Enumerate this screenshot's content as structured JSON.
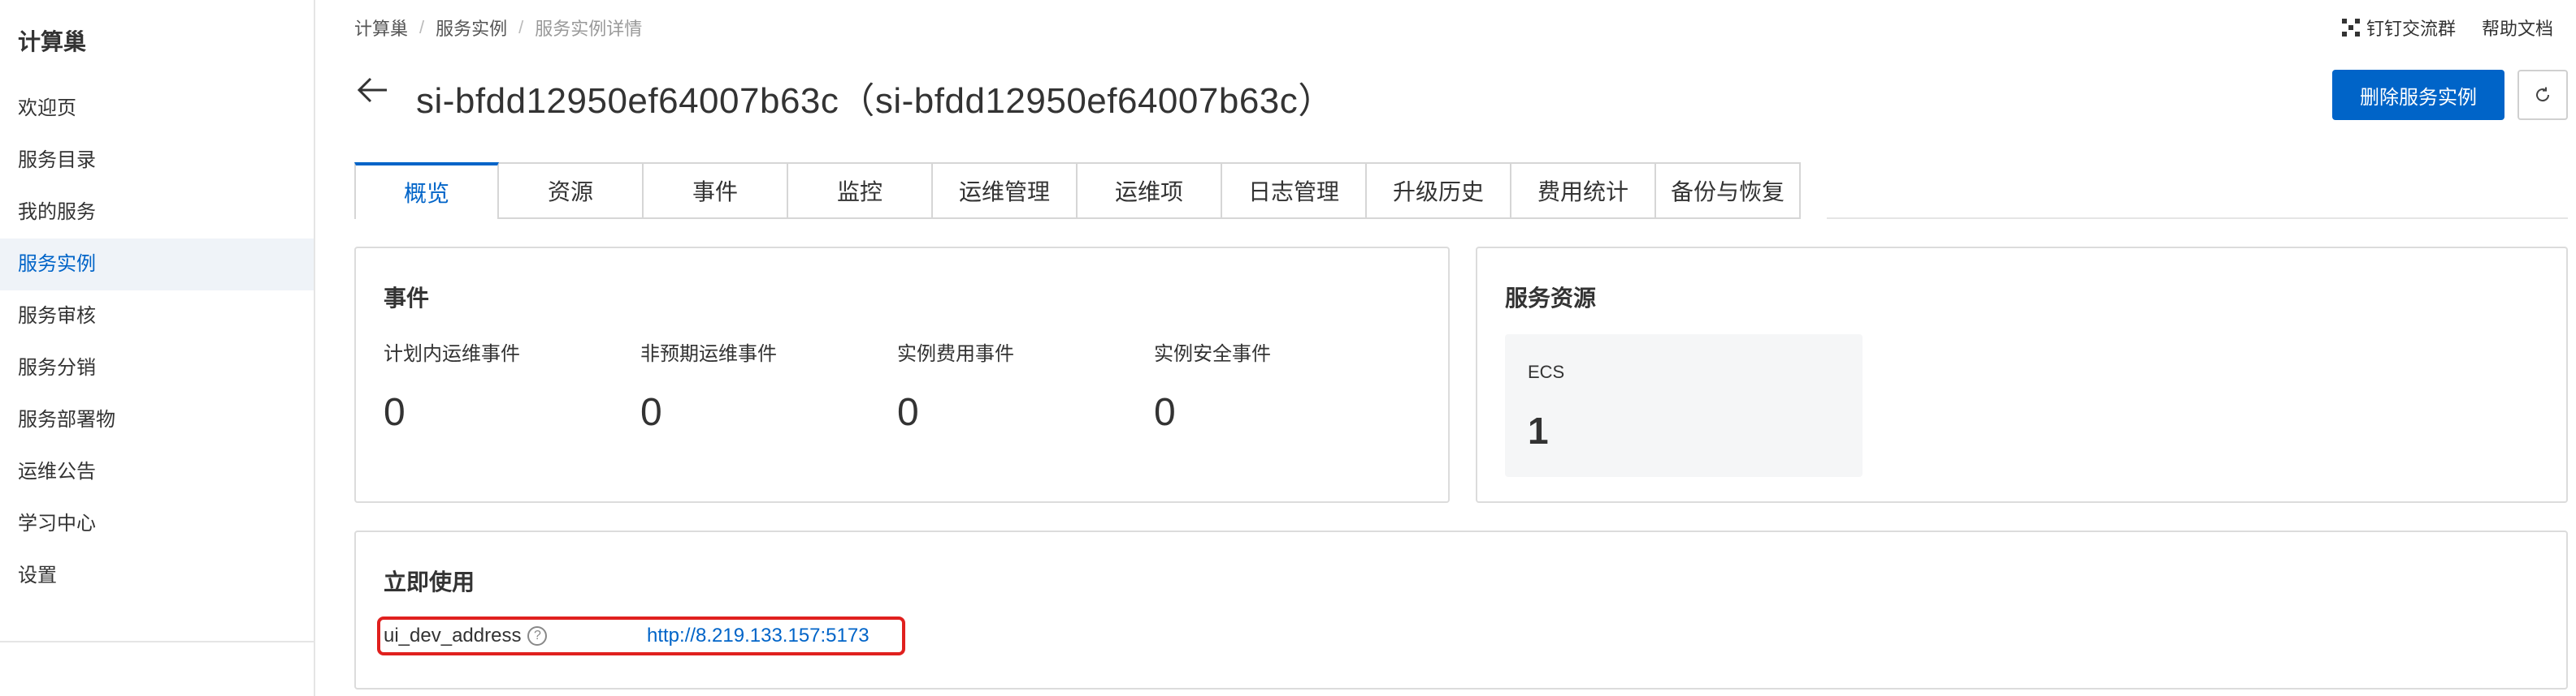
{
  "sidebar": {
    "title": "计算巢",
    "items": [
      {
        "label": "欢迎页"
      },
      {
        "label": "服务目录"
      },
      {
        "label": "我的服务"
      },
      {
        "label": "服务实例"
      },
      {
        "label": "服务审核"
      },
      {
        "label": "服务分销"
      },
      {
        "label": "服务部署物"
      },
      {
        "label": "运维公告"
      },
      {
        "label": "学习中心"
      },
      {
        "label": "设置"
      }
    ],
    "active_item": "服务实例"
  },
  "breadcrumb": [
    "计算巢",
    "服务实例",
    "服务实例详情"
  ],
  "top_links": {
    "dingtalk": "钉钉交流群",
    "help": "帮助文档",
    "dingtalk_icon": "qr-code-icon"
  },
  "header": {
    "title": "si-bfdd12950ef64007b63c（si-bfdd12950ef64007b63c）",
    "back_icon": "arrow-left-icon",
    "delete_button": "删除服务实例",
    "refresh_icon": "refresh-icon"
  },
  "tabs": [
    {
      "label": "概览"
    },
    {
      "label": "资源"
    },
    {
      "label": "事件"
    },
    {
      "label": "监控"
    },
    {
      "label": "运维管理"
    },
    {
      "label": "运维项"
    },
    {
      "label": "日志管理"
    },
    {
      "label": "升级历史"
    },
    {
      "label": "费用统计"
    },
    {
      "label": "备份与恢复"
    }
  ],
  "active_tab": "概览",
  "events_card": {
    "title": "事件",
    "metrics": [
      {
        "label": "计划内运维事件",
        "value": "0"
      },
      {
        "label": "非预期运维事件",
        "value": "0"
      },
      {
        "label": "实例费用事件",
        "value": "0"
      },
      {
        "label": "实例安全事件",
        "value": "0"
      }
    ]
  },
  "resource_card": {
    "title": "服务资源",
    "resources": [
      {
        "label": "ECS",
        "value": "1"
      }
    ]
  },
  "usage_card": {
    "title": "立即使用",
    "key": "ui_dev_address",
    "help_icon": "question-circle-icon",
    "value": "http://8.219.133.157:5173"
  },
  "colors": {
    "accent": "#0064c8",
    "highlight": "#e0201e",
    "active_bg": "#eff3f8"
  }
}
